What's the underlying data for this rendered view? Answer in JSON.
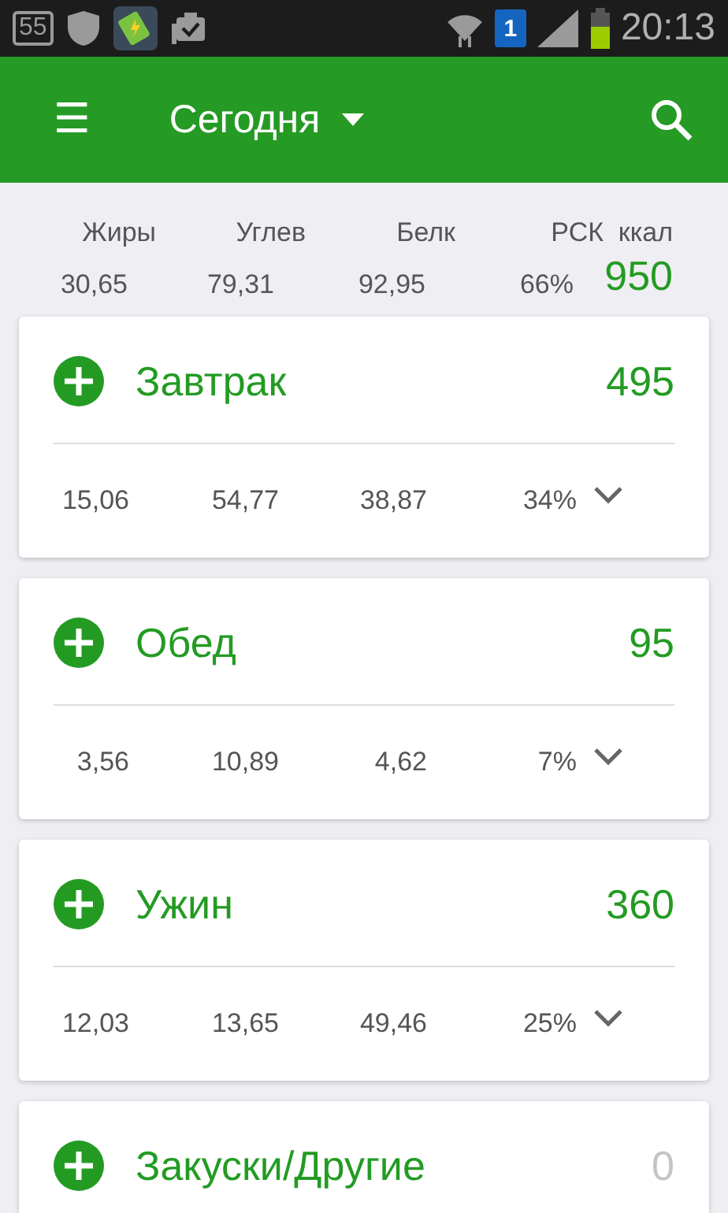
{
  "status_bar": {
    "notification_count": "55",
    "sim_number": "1",
    "time": "20:13"
  },
  "toolbar": {
    "menu_icon": "☰",
    "title": "Сегодня"
  },
  "summary": {
    "labels": [
      "Жиры",
      "Углев",
      "Белк",
      "РСК"
    ],
    "kcal_label": "ккал",
    "values": [
      "30,65",
      "79,31",
      "92,95",
      "66%"
    ],
    "kcal": "950"
  },
  "meals": [
    {
      "name": "Завтрак",
      "kcal": "495",
      "empty": false,
      "macros": [
        "15,06",
        "54,77",
        "38,87",
        "34%"
      ],
      "expanded": false
    },
    {
      "name": "Обед",
      "kcal": "95",
      "empty": false,
      "macros": [
        "3,56",
        "10,89",
        "4,62",
        "7%"
      ],
      "expanded": false
    },
    {
      "name": "Ужин",
      "kcal": "360",
      "empty": false,
      "macros": [
        "12,03",
        "13,65",
        "49,46",
        "25%"
      ],
      "expanded": false
    },
    {
      "name": "Закуски/Другие",
      "kcal": "0",
      "empty": true
    }
  ]
}
